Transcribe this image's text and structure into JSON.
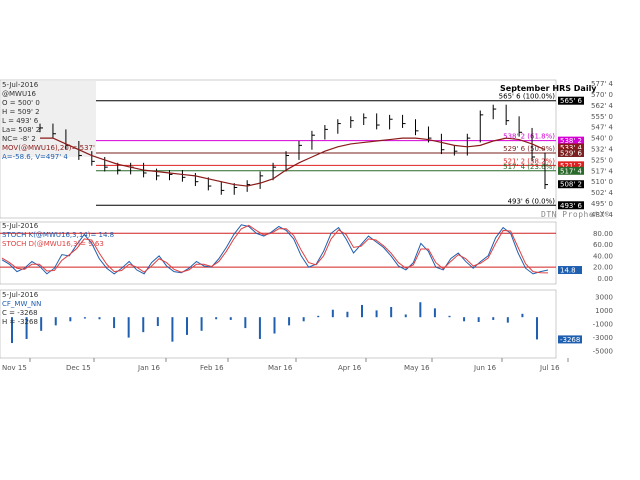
{
  "price_panel": {
    "date": "5-Jul-2016",
    "symbol": "@MWU16",
    "ohlc": [
      "O = 500' 0",
      "H = 509' 2",
      "L = 493' 6",
      "La= 508' 2",
      "NC= -8' 2"
    ],
    "ma_label": "MOV(@MWU16),20)= 537'",
    "av_label": "A=-58.6, V=497' 4",
    "title": "September HRS Daily",
    "brand": "DTN ProphetX®"
  },
  "stoch_panel": {
    "date": "5-Jul-2016",
    "k_label": "STOCH K(@MWU16,3,14)= 14.8",
    "d_label": "STOCH D(@MWU16,3)= 9.63"
  },
  "cf_panel": {
    "date": "5-Jul-2016",
    "name_label": "CF_MW_NN",
    "c_label": "C = -3268",
    "h_label": "H = -3268"
  },
  "chart_data": [
    {
      "type": "candlestick",
      "title": "September HRS Daily",
      "ylim": [
        485,
        580
      ],
      "y_ticks": [
        "577' 4",
        "570' 0",
        "562' 4",
        "555' 0",
        "547' 4",
        "540' 0",
        "532' 4",
        "525' 0",
        "517' 4",
        "510' 0",
        "502' 4",
        "495' 0",
        "487' 4"
      ],
      "y_tick_values": [
        577.5,
        570,
        562.5,
        555,
        547.5,
        540,
        532.5,
        525,
        517.5,
        510,
        502.5,
        495,
        487.5
      ],
      "x_labels": [
        "Nov 15",
        "Dec 15",
        "Jan 16",
        "Feb 16",
        "Mar 16",
        "Apr 16",
        "May 16",
        "Jun 16",
        "Jul 16"
      ],
      "fib_levels": [
        {
          "label": "565' 6 (100.0%)",
          "value": 565.75,
          "color": "#000000"
        },
        {
          "label": "538' 2 (61.8%)",
          "value": 538.25,
          "color": "#d400d4"
        },
        {
          "label": "529' 6 (50.0%)",
          "value": 529.75,
          "color": "#7a1f1f"
        },
        {
          "label": "521' 2 (38.2%)",
          "value": 521.25,
          "color": "#e02020"
        },
        {
          "label": "517' 4 (23.6%)",
          "value": 517.5,
          "color": "#2a6a2a"
        },
        {
          "label": "493' 6 (0.0%)",
          "value": 493.75,
          "color": "#000000"
        }
      ],
      "price_tags": [
        {
          "text": "565' 6",
          "value": 565.75,
          "bg": "#000000"
        },
        {
          "text": "538' 2",
          "value": 538.25,
          "bg": "#d400d4"
        },
        {
          "text": "533' 4",
          "value": 533.5,
          "bg": "#8b1a1a"
        },
        {
          "text": "529' 6",
          "value": 529.75,
          "bg": "#7a1f1f"
        },
        {
          "text": "521' 2",
          "value": 521.25,
          "bg": "#e02020"
        },
        {
          "text": "517' 4",
          "value": 517.5,
          "bg": "#2a6a2a"
        },
        {
          "text": "508' 2",
          "value": 508.25,
          "bg": "#000000"
        },
        {
          "text": "493' 6",
          "value": 493.75,
          "bg": "#000000"
        }
      ],
      "series": [
        {
          "name": "MOV(@MWU16),20)",
          "color": "#8b1a1a",
          "values": [
            540,
            540,
            536,
            532,
            528,
            525,
            522,
            520,
            518,
            517,
            516,
            515,
            514,
            512,
            510,
            508,
            507,
            509,
            512,
            518,
            523,
            527,
            531,
            534,
            536,
            537,
            538,
            539,
            540,
            540,
            539,
            537,
            535,
            534,
            535,
            538,
            540,
            539,
            536,
            532
          ]
        },
        {
          "name": "closes",
          "values": [
            547,
            543,
            535,
            528,
            524,
            520,
            518,
            520,
            516,
            514,
            515,
            513,
            510,
            507,
            504,
            506,
            508,
            514,
            520,
            528,
            535,
            542,
            546,
            550,
            552,
            554,
            549,
            553,
            550,
            545,
            540,
            532,
            531,
            540,
            556,
            560,
            552,
            544,
            527,
            508
          ]
        }
      ]
    },
    {
      "type": "line",
      "ylim": [
        -10,
        100
      ],
      "y_ticks": [
        80,
        60,
        40,
        20,
        0
      ],
      "y_tick_labels": [
        "80.00",
        "60.00",
        "40.00",
        "20.00",
        "0.00"
      ],
      "ref_lines": [
        80,
        20
      ],
      "series": [
        {
          "name": "STOCH K(@MWU16,3,14)",
          "color": "#1f5fb0",
          "values": [
            33,
            25,
            12,
            18,
            30,
            22,
            8,
            18,
            42,
            40,
            60,
            78,
            62,
            35,
            18,
            8,
            18,
            30,
            15,
            8,
            28,
            40,
            22,
            12,
            10,
            18,
            30,
            22,
            20,
            35,
            55,
            78,
            95,
            92,
            80,
            75,
            82,
            92,
            85,
            70,
            40,
            20,
            25,
            48,
            80,
            90,
            70,
            45,
            60,
            75,
            65,
            55,
            40,
            22,
            15,
            28,
            62,
            48,
            20,
            15,
            35,
            45,
            30,
            18,
            30,
            40,
            72,
            90,
            80,
            45,
            18,
            8,
            12,
            14.8
          ]
        },
        {
          "name": "STOCH D(@MWU16,3)",
          "color": "#e04040",
          "values": [
            36,
            28,
            18,
            16,
            25,
            25,
            13,
            14,
            32,
            42,
            53,
            70,
            68,
            45,
            25,
            12,
            14,
            25,
            20,
            11,
            22,
            35,
            28,
            16,
            11,
            15,
            25,
            25,
            21,
            30,
            48,
            70,
            88,
            94,
            85,
            77,
            80,
            88,
            88,
            76,
            50,
            28,
            24,
            40,
            70,
            86,
            78,
            55,
            57,
            70,
            68,
            58,
            45,
            28,
            18,
            24,
            52,
            52,
            28,
            17,
            30,
            42,
            35,
            22,
            27,
            36,
            62,
            85,
            84,
            55,
            26,
            12,
            10,
            9.63
          ]
        }
      ]
    },
    {
      "type": "bar",
      "ylim": [
        -6000,
        4000
      ],
      "y_ticks": [
        3000,
        1000,
        -1000,
        -3000,
        -5000
      ],
      "y_tick_labels": [
        "3000",
        "1000",
        "-1000",
        "-3000",
        "-5000"
      ],
      "tag": "-3268",
      "series": [
        {
          "name": "CF_MW_NN",
          "color": "#1f5fb0",
          "values": [
            -3800,
            -3200,
            -2000,
            -1200,
            -600,
            -200,
            -300,
            -1600,
            -3000,
            -2200,
            -1300,
            -3600,
            -2600,
            -2000,
            -300,
            -400,
            -1600,
            -3200,
            -2400,
            -1200,
            -600,
            200,
            1100,
            800,
            1800,
            1000,
            1500,
            400,
            2200,
            1300,
            200,
            -600,
            -700,
            -400,
            -800,
            500,
            -3268
          ]
        }
      ]
    }
  ]
}
